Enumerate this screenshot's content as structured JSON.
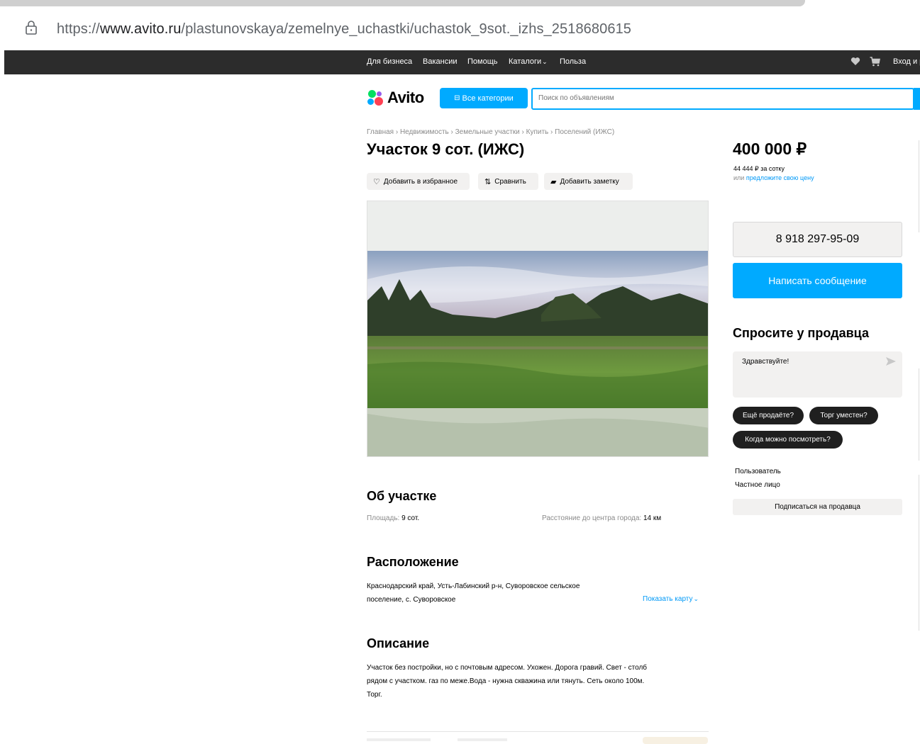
{
  "browser": {
    "url_scheme": "https://",
    "url_domain": "www.avito.ru",
    "url_path": "/plastunovskaya/zemelnye_uchastki/uchastok_9sot._izhs_2518680615"
  },
  "topnav": {
    "items": [
      "Для бизнеса",
      "Вакансии",
      "Помощь",
      "Каталоги",
      "Польза"
    ],
    "catalog_chevron": "⌄",
    "login": "Вход и р"
  },
  "header": {
    "logo_text": "Avito",
    "categories_button": "Все категории",
    "search_placeholder": "Поиск по объявлениям"
  },
  "listing": {
    "breadcrumb": "Главная › Недвижимость › Земельные участки › Купить › Поселений (ИЖС)",
    "title": "Участок 9 сот. (ИЖС)",
    "actions": {
      "favorite": "Добавить в избранное",
      "compare": "Сравнить",
      "note": "Добавить заметку"
    }
  },
  "about": {
    "heading": "Об участке",
    "area_label": "Площадь:",
    "area_value": "9 сот.",
    "distance_label": "Расстояние до центра города:",
    "distance_value": "14 км"
  },
  "location": {
    "heading": "Расположение",
    "address_line1": "Краснодарский край, Усть-Лабинский р-н, Суворовское сельское",
    "address_line2": "поселение, с. Суворовское",
    "show_map": "Показать карту"
  },
  "description": {
    "heading": "Описание",
    "line1": "Участок без постройки, но с почтовым адресом. Ухожен. Дорога гравий. Свет - столб",
    "line2": "рядом с участком. газ по меже.Вода - нужна скважина или тянуть. Сеть около 100м.",
    "line3": "Торг."
  },
  "sidebar": {
    "price": "400 000 ₽",
    "price_per_sotka": "44 444 ₽ за сотку",
    "offer_prefix": "или",
    "offer_link": "предложите свою цену",
    "phone": "8 918 297-95-09",
    "message_button": "Написать сообщение",
    "ask_title": "Спросите у продавца",
    "ask_input": "Здравствуйте!",
    "chips": [
      "Ещё продаёте?",
      "Торг уместен?",
      "Когда можно посмотреть?"
    ],
    "seller_name": "Пользователь",
    "seller_type": "Частное лицо",
    "subscribe": "Подписаться на продавца"
  },
  "colors": {
    "accent": "#00aaff",
    "link": "#0099f7",
    "topnav_bg": "#2c2c2c",
    "chip_bg": "#1f1f1f"
  }
}
